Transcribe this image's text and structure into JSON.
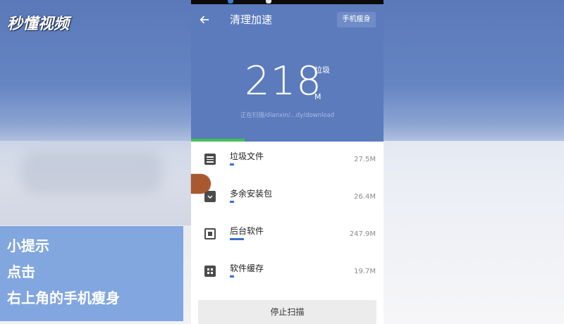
{
  "watermark": {
    "logo_text": "秒懂视频"
  },
  "tip": {
    "lines": [
      "小提示",
      "点击",
      "右上角的手机瘦身"
    ]
  },
  "app": {
    "title": "清理加速",
    "top_right_button": "手机瘦身",
    "junk_size": "218",
    "junk_label": "垃圾",
    "junk_unit": "M",
    "scan_path": "正在扫描/dianxin/...dy/download",
    "scan_progress": 0.28,
    "items": [
      {
        "name": "垃圾文件",
        "size": "27.5M",
        "icon": "document-icon",
        "bar_fraction": 0.03
      },
      {
        "name": "多余安装包",
        "size": "26.4M",
        "icon": "package-icon",
        "bar_fraction": 0.03
      },
      {
        "name": "后台软件",
        "size": "247.9M",
        "icon": "chip-icon",
        "bar_fraction": 0.1
      },
      {
        "name": "软件缓存",
        "size": "19.7M",
        "icon": "apps-grid-icon",
        "bar_fraction": 0.03
      }
    ],
    "stop_button": "停止扫描"
  },
  "colors": {
    "header_blue": "#5c7bbd",
    "progress_green": "#45c05a",
    "bar_blue": "#3b6fd1"
  }
}
